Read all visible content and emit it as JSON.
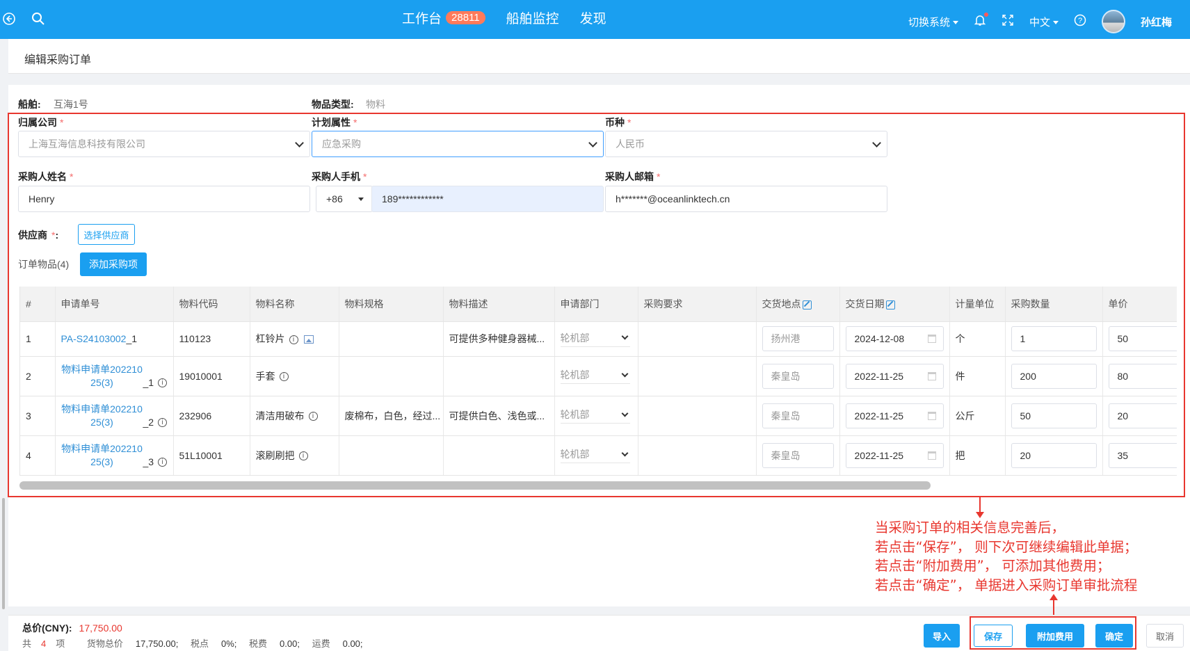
{
  "topbar": {
    "nav": [
      {
        "label": "工作台",
        "badge": "28811"
      },
      {
        "label": "船舶监控"
      },
      {
        "label": "发现"
      }
    ],
    "switch_system": "切换系统",
    "language": "中文",
    "user_name": "孙红梅"
  },
  "page": {
    "title": "编辑采购订单"
  },
  "info": {
    "vessel_label": "船舶:",
    "vessel_value": "互海1号",
    "item_type_label": "物品类型:",
    "item_type_value": "物料"
  },
  "form": {
    "company_label": "归属公司",
    "company_value": "上海互海信息科技有限公司",
    "plan_label": "计划属性",
    "plan_value": "应急采购",
    "currency_label": "币种",
    "currency_value": "人民币",
    "buyer_name_label": "采购人姓名",
    "buyer_name_value": "Henry",
    "buyer_phone_label": "采购人手机",
    "phone_code": "+86",
    "phone_value": "189************",
    "buyer_email_label": "采购人邮箱",
    "email_value": "h*******@oceanlinktech.cn",
    "supplier_label": "供应商",
    "supplier_button": "选择供应商",
    "order_items_label": "订单物品(4)",
    "add_item_button": "添加采购项",
    "required_mark": "*"
  },
  "table": {
    "headers": [
      "#",
      "申请单号",
      "物料代码",
      "物料名称",
      "物料规格",
      "物料描述",
      "申请部门",
      "采购要求",
      "交货地点",
      "交货日期",
      "计量单位",
      "采购数量",
      "单价"
    ],
    "rows": [
      {
        "no": "1",
        "req_no": "PA-S24103002",
        "req_suffix": "_1",
        "code": "110123",
        "name": "杠铃片",
        "spec": "",
        "desc": "可提供多种健身器械...",
        "dept": "轮机部",
        "place": "扬州港",
        "date": "2024-12-08",
        "unit": "个",
        "qty": "1",
        "price": "50"
      },
      {
        "no": "2",
        "req_no_l1": "物料申请单202210",
        "req_no_l2": "25(3)",
        "req_suffix": "_1",
        "code": "19010001",
        "name": "手套",
        "spec": "",
        "desc": "",
        "dept": "轮机部",
        "place": "秦皇岛",
        "date": "2022-11-25",
        "unit": "件",
        "qty": "200",
        "price": "80"
      },
      {
        "no": "3",
        "req_no_l1": "物料申请单202210",
        "req_no_l2": "25(3)",
        "req_suffix": "_2",
        "code": "232906",
        "name": "清洁用破布",
        "spec": "废棉布，白色，经过...",
        "desc": "可提供白色、浅色或...",
        "dept": "轮机部",
        "place": "秦皇岛",
        "date": "2022-11-25",
        "unit": "公斤",
        "qty": "50",
        "price": "20"
      },
      {
        "no": "4",
        "req_no_l1": "物料申请单202210",
        "req_no_l2": "25(3)",
        "req_suffix": "_3",
        "code": "51L10001",
        "name": "滚刷刷把",
        "spec": "",
        "desc": "",
        "dept": "轮机部",
        "place": "秦皇岛",
        "date": "2022-11-25",
        "unit": "把",
        "qty": "20",
        "price": "35"
      }
    ]
  },
  "annotation": {
    "lines": [
      "当采购订单的相关信息完善后，",
      "若点击“保存”， 则下次可继续编辑此单据；",
      "若点击“附加费用”， 可添加其他费用；",
      "若点击“确定”， 单据进入采购订单审批流程"
    ]
  },
  "footer": {
    "total_label": "总价(CNY):",
    "total_value": "17,750.00",
    "count_prefix": "共",
    "count_value": "4",
    "count_suffix": "项",
    "goods_label": "货物总价",
    "goods_value": "17,750.00;",
    "tax_rate_label": "税点",
    "tax_rate_value": "0%;",
    "tax_label": "税费",
    "tax_value": "0.00;",
    "freight_label": "运费",
    "freight_value": "0.00;",
    "buttons": {
      "import": "导入",
      "save": "保存",
      "extra_fee": "附加费用",
      "confirm": "确定",
      "cancel": "取消"
    }
  },
  "colors": {
    "brand": "#1a9ff0",
    "highlight": "#e8372f",
    "required": "#f56c6c"
  }
}
